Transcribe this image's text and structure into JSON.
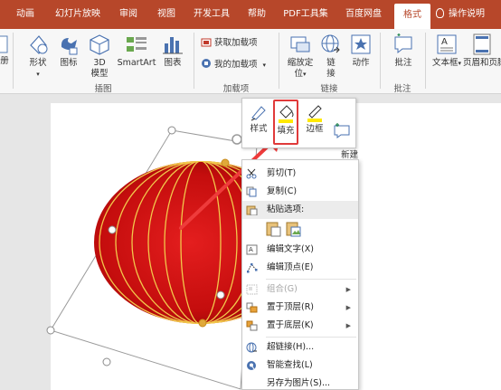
{
  "tabs": [
    {
      "label": "动画",
      "active": false
    },
    {
      "label": "幻灯片放映",
      "active": false
    },
    {
      "label": "审阅",
      "active": false
    },
    {
      "label": "视图",
      "active": false
    },
    {
      "label": "开发工具",
      "active": false
    },
    {
      "label": "帮助",
      "active": false
    },
    {
      "label": "PDF工具集",
      "active": false
    },
    {
      "label": "百度网盘",
      "active": false
    },
    {
      "label": "格式",
      "active": true
    }
  ],
  "tell_me": "操作说明",
  "ribbon": {
    "left_cut_label": "册",
    "illustrations": {
      "shapes": "形状",
      "icons": "图标",
      "model3d": "3D\n模型",
      "smartart": "SmartArt",
      "chart": "图表",
      "group_label": "插图"
    },
    "addins": {
      "get_addins": "获取加载项",
      "my_addins": "我的加载项",
      "group_label": "加载项"
    },
    "links": {
      "zoom": "缩放定\n位",
      "link": "链\n接",
      "action": "动作",
      "group_label": "链接"
    },
    "comments": {
      "comment": "批注",
      "group_label": "批注"
    },
    "text": {
      "textbox": "文本框",
      "header_footer": "页眉和页脚"
    }
  },
  "mini_toolbar": {
    "style": "样式",
    "fill": "填充",
    "outline": "边框",
    "new_comment": "新建\n批注"
  },
  "context_menu": {
    "cut": "剪切(T)",
    "copy": "复制(C)",
    "paste_options": "粘贴选项:",
    "edit_text": "编辑文字(X)",
    "edit_points": "编辑顶点(E)",
    "group": "组合(G)",
    "bring_to_front": "置于顶层(R)",
    "send_to_back": "置于底层(K)",
    "hyperlink": "超链接(H)...",
    "smart_lookup": "智能查找(L)",
    "save_as_picture": "另存为图片(S)..."
  },
  "colors": {
    "accent": "#b7472a",
    "highlight_border": "#e03a3a",
    "shape_fill": "#cc1111",
    "shape_lines": "#f2c84b"
  }
}
